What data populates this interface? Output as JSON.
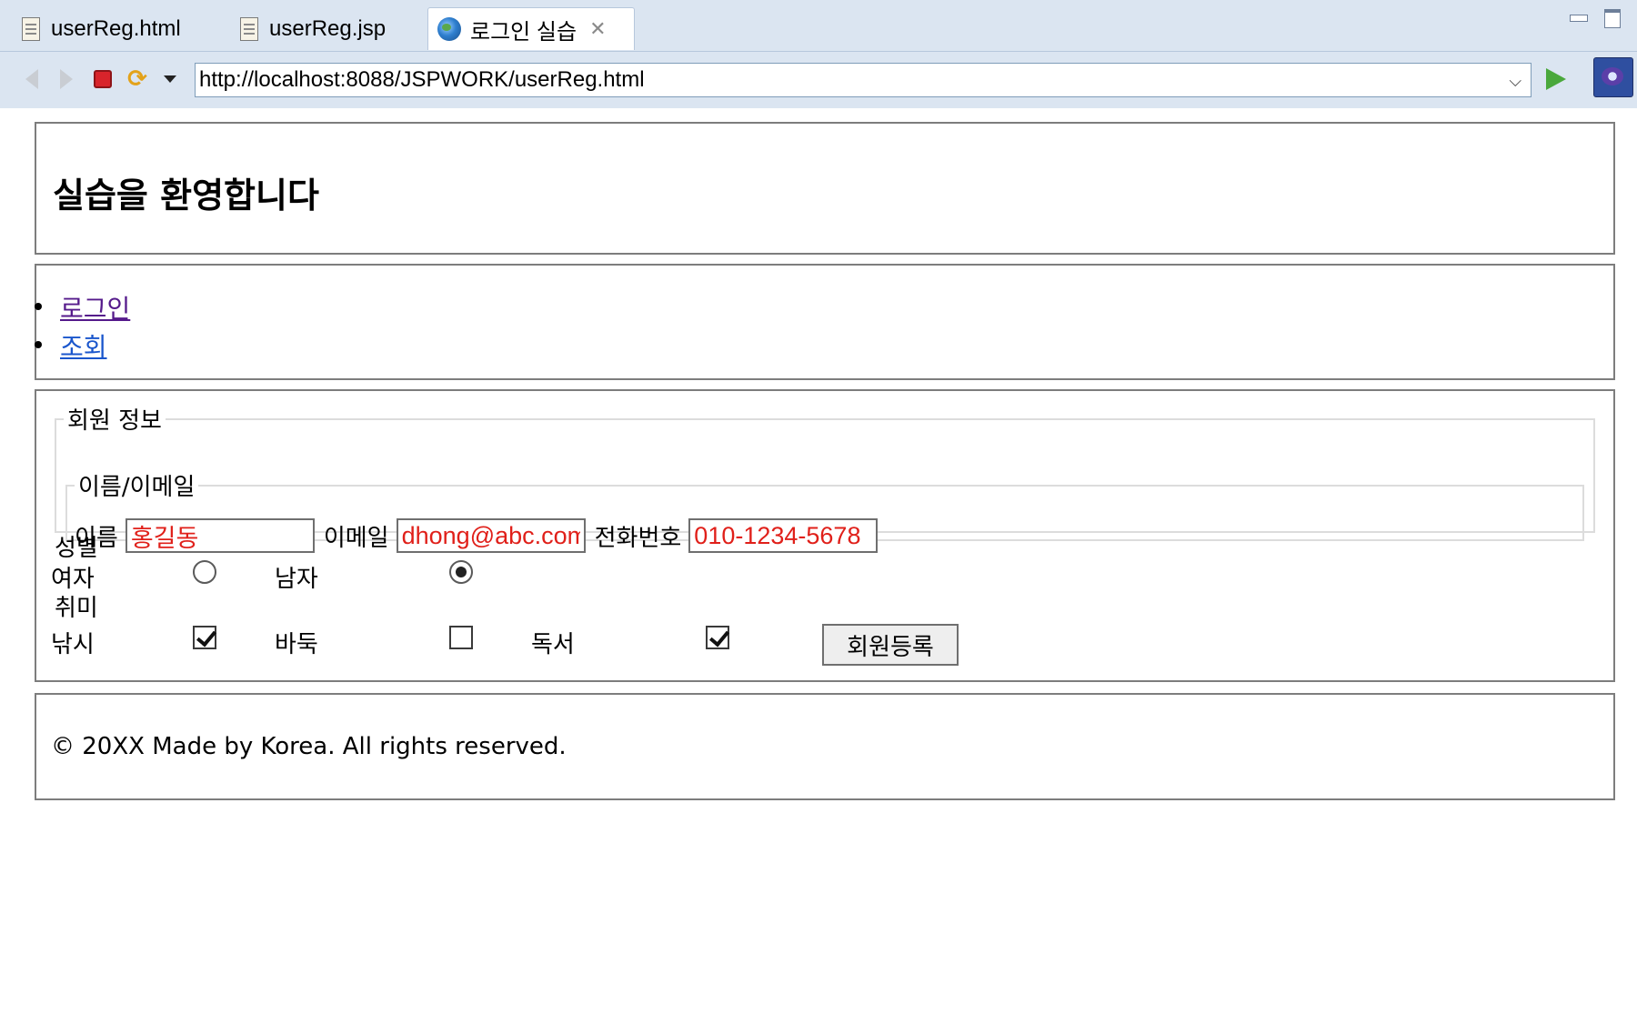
{
  "tabs": [
    {
      "label": "userReg.html",
      "icon": "file-icon",
      "active": false
    },
    {
      "label": "userReg.jsp",
      "icon": "file-icon",
      "active": false
    },
    {
      "label": "로그인 실습",
      "icon": "globe-icon",
      "active": true
    }
  ],
  "toolbar": {
    "url": "http://localhost:8088/JSPWORK/userReg.html"
  },
  "header": {
    "title": "실습을 환영합니다"
  },
  "nav": {
    "items": [
      {
        "label": "로그인"
      },
      {
        "label": "조회"
      }
    ]
  },
  "form": {
    "outer_legend": "회원 정보",
    "inner_legend": "이름/이메일",
    "name_label": "이름",
    "name_value": "홍길동",
    "email_label": "이메일",
    "email_value": "dhong@abc.com",
    "phone_label": "전화번호",
    "phone_value": "010-1234-5678",
    "gender_label": "성별",
    "gender_options": [
      {
        "label": "여자",
        "checked": false
      },
      {
        "label": "남자",
        "checked": true
      }
    ],
    "hobby_label": "취미",
    "hobby_options": [
      {
        "label": "낚시",
        "checked": true
      },
      {
        "label": "바둑",
        "checked": false
      },
      {
        "label": "독서",
        "checked": true
      }
    ],
    "submit_label": "회원등록"
  },
  "footer": {
    "text": "© 20XX Made by Korea. All rights reserved."
  },
  "colors": {
    "chrome": "#dbe5f1",
    "input_text": "#e0201a",
    "visited_link": "#551a8b",
    "link": "#1a56cc"
  }
}
